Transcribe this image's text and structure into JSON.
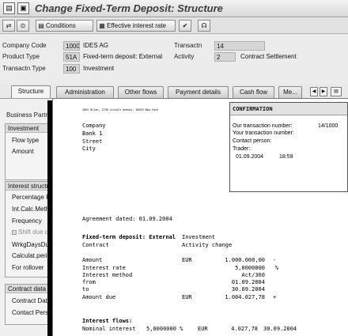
{
  "window": {
    "title": "Change Fixed-Term Deposit: Structure"
  },
  "toolbar": {
    "conditions_label": "Conditions",
    "effective_rate_label": "Effective interest rate"
  },
  "header": {
    "company_code_label": "Company Code",
    "company_code_value": "1000",
    "company_name": "IDES AG",
    "product_type_label": "Product Type",
    "product_type_value": "51A",
    "product_type_text": "Fixed-term deposit: External",
    "transactn_type_label": "Transactn Type",
    "transactn_type_value": "100",
    "transactn_type_text": "Investment",
    "transactn_label": "Transactn",
    "transactn_value": "14",
    "activity_label": "Activity",
    "activity_value": "2",
    "activity_text": "Contract Settlement"
  },
  "tabs": [
    {
      "label": "Structure"
    },
    {
      "label": "Administration"
    },
    {
      "label": "Other flows"
    },
    {
      "label": "Payment details"
    },
    {
      "label": "Cash flow"
    },
    {
      "label": "Me..."
    }
  ],
  "left_panel": {
    "business_partner_label": "Business Partn",
    "investment_group": {
      "title": "Investment",
      "items": [
        "Flow type",
        "Amount"
      ]
    },
    "interest_group": {
      "title": "Interest structu",
      "items": [
        "Percentage R",
        "Int.Calc.Metho",
        "Frequency",
        "Shift due d",
        "WrkgDaysDu",
        "Calculat.perio",
        "For rollover"
      ]
    },
    "contract_group": {
      "title": "Contract data",
      "items": [
        "Contract Date",
        "Contact Perso"
      ]
    }
  },
  "document": {
    "sender_line": "IDES Bilan, 1230 Lincoln Avenue, 10019 New York",
    "address": [
      "Company",
      "Bank 1",
      "Street",
      "City"
    ],
    "agreement": "Agreement dated: 01.09.2004",
    "product_label": "Fixed-term deposit: External",
    "product_value": "Investment",
    "contract_label": "Contract",
    "contract_value": "Activity change",
    "rows": [
      {
        "label": "Amount",
        "cur": "EUR",
        "value": "1.000.000,00",
        "sign": "-"
      },
      {
        "label": "Interest rate",
        "cur": "",
        "value": "5,0000000",
        "sign": "%"
      },
      {
        "label": "Interest method",
        "cur": "",
        "value": "Act/360",
        "sign": ""
      },
      {
        "label": "from",
        "cur": "",
        "value": "01.09.2004",
        "sign": ""
      },
      {
        "label": "to",
        "cur": "",
        "value": "30.09.2004",
        "sign": ""
      },
      {
        "label": "Amount due",
        "cur": "EUR",
        "value": "1.004.027,78",
        "sign": "+"
      }
    ],
    "interest_flows_title": "Interest flows:",
    "interest_flow": {
      "label": "Nominal interest",
      "rate": "5,0000000 %",
      "cur": "EUR",
      "amount": "4.027,78",
      "date": "30.09.2004"
    }
  },
  "confirmation": {
    "title": "CONFIRMATION",
    "our_number_label": "Our transaction number:",
    "our_number_value": "14/1000",
    "your_number_label": "Your transaction number:",
    "contact_label": "Contact person:",
    "trader_label": "Trader:",
    "date": "01.09.2004",
    "time": "18:59"
  }
}
